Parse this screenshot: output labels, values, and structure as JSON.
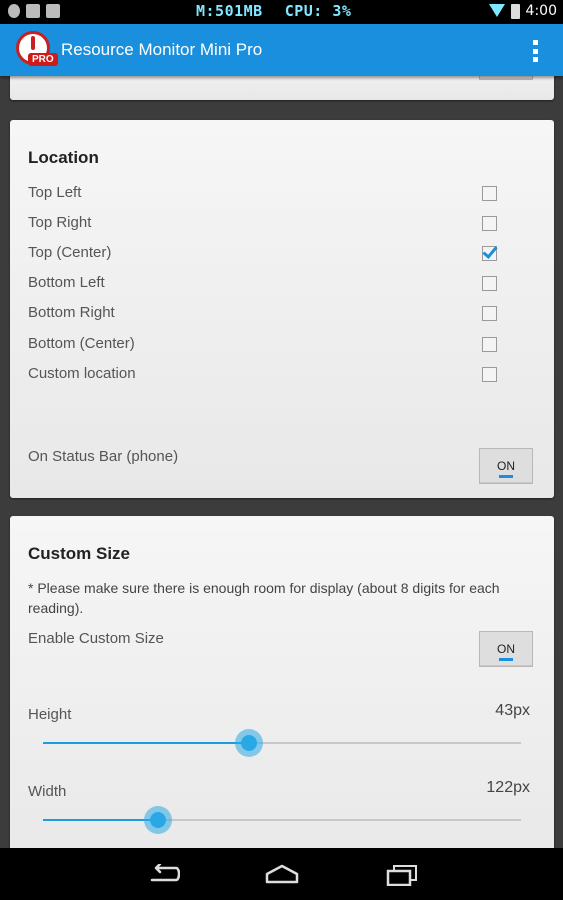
{
  "status_bar": {
    "memory": "M:501MB",
    "cpu": "CPU: 3%",
    "time": "4:00",
    "left_icons": [
      "notification-icon",
      "cat-icon",
      "image-icon"
    ],
    "right_icons": [
      "wifi-icon",
      "battery-icon"
    ]
  },
  "app_bar": {
    "title": "Resource Monitor Mini Pro",
    "logo_badge": "PRO",
    "menu_icon": "overflow-menu-icon"
  },
  "location": {
    "title": "Location",
    "options": [
      {
        "label": "Top Left",
        "checked": false
      },
      {
        "label": "Top Right",
        "checked": false
      },
      {
        "label": "Top (Center)",
        "checked": true
      },
      {
        "label": "Bottom Left",
        "checked": false
      },
      {
        "label": "Bottom Right",
        "checked": false
      },
      {
        "label": "Bottom (Center)",
        "checked": false
      },
      {
        "label": "Custom location",
        "checked": false
      }
    ],
    "status_bar_label": "On Status Bar (phone)",
    "status_bar_toggle": "ON"
  },
  "custom_size": {
    "title": "Custom Size",
    "note": "* Please make sure there is enough room for display (about 8 digits for each reading).",
    "enable_label": "Enable Custom Size",
    "enable_toggle": "ON",
    "height_label": "Height",
    "height_value": "43px",
    "height_fraction": 0.43,
    "width_label": "Width",
    "width_value": "122px",
    "width_fraction": 0.24
  },
  "colors": {
    "accent": "#1a8fdd",
    "slider": "#2aa8e6",
    "status_text": "#7fe7ff"
  }
}
